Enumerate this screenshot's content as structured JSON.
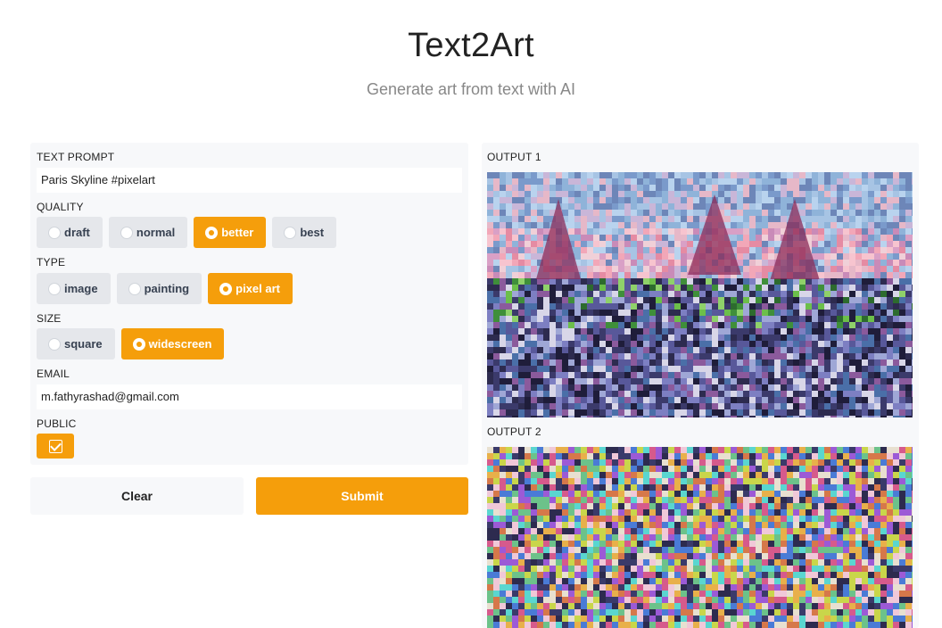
{
  "header": {
    "title": "Text2Art",
    "subtitle": "Generate art from text with AI"
  },
  "form": {
    "prompt_label": "TEXT PROMPT",
    "prompt_value": "Paris Skyline #pixelart",
    "quality_label": "QUALITY",
    "quality_options": [
      "draft",
      "normal",
      "better",
      "best"
    ],
    "quality_selected": "better",
    "type_label": "TYPE",
    "type_options": [
      "image",
      "painting",
      "pixel art"
    ],
    "type_selected": "pixel art",
    "size_label": "SIZE",
    "size_options": [
      "square",
      "widescreen"
    ],
    "size_selected": "widescreen",
    "email_label": "EMAIL",
    "email_value": "m.fathyrashad@gmail.com",
    "public_label": "PUBLIC",
    "public_checked": true
  },
  "actions": {
    "clear_label": "Clear",
    "submit_label": "Submit"
  },
  "outputs": {
    "output1_label": "OUTPUT 1",
    "output2_label": "OUTPUT 2"
  },
  "colors": {
    "accent": "#f59e0b",
    "panel_bg": "#f7f8fa",
    "option_bg": "#e5e7eb"
  }
}
